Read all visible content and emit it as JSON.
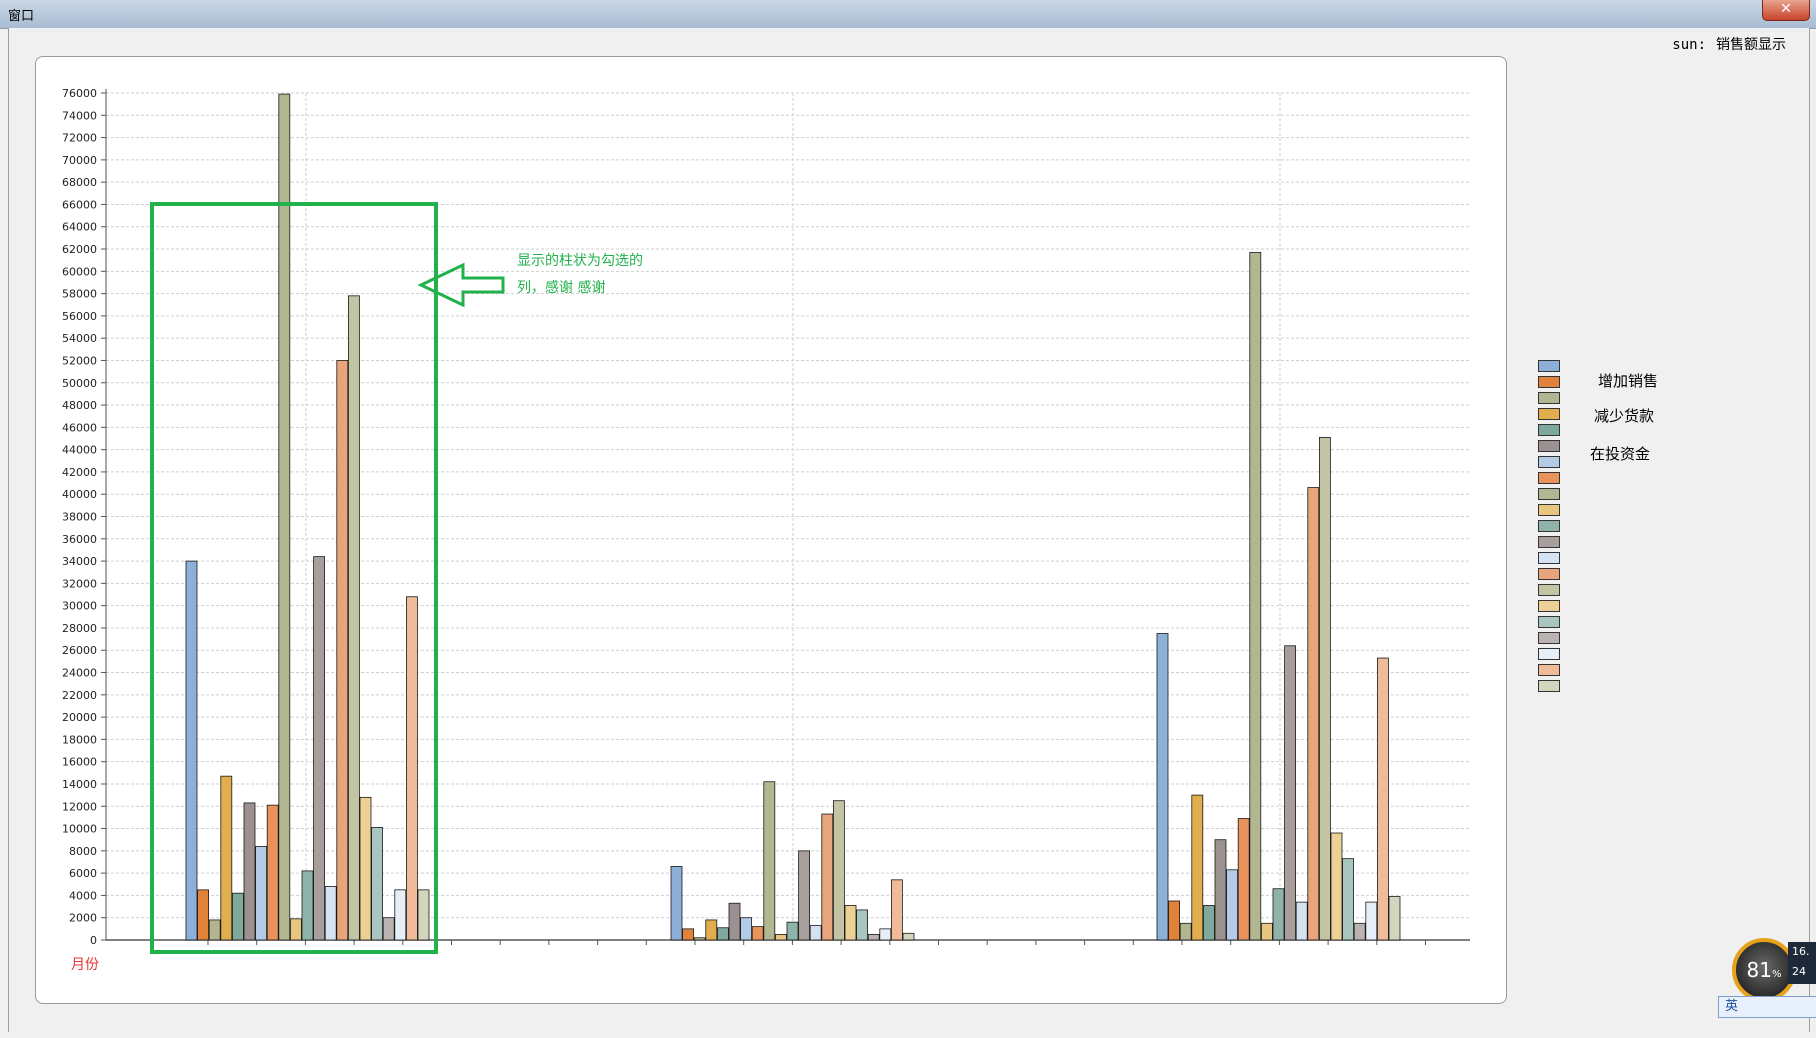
{
  "window": {
    "title": "窗口",
    "close_glyph": "✕"
  },
  "header": {
    "user": "sun:",
    "title": "销售额显示"
  },
  "chart_data": {
    "type": "bar",
    "categories": [
      "",
      "",
      ""
    ],
    "ylim": [
      0,
      76000
    ],
    "ytick_step": 2000,
    "ylabel": "",
    "xlabel": "月份",
    "grid": true,
    "series": [
      {
        "color": "#8db0d8",
        "values": [
          34000,
          6600,
          27500
        ]
      },
      {
        "color": "#e0823a",
        "values": [
          4500,
          1000,
          3500
        ]
      },
      {
        "color": "#b2b690",
        "values": [
          1800,
          200,
          1500
        ]
      },
      {
        "color": "#e2ad4e",
        "values": [
          14700,
          1800,
          13000
        ]
      },
      {
        "color": "#7fa89e",
        "values": [
          4200,
          1100,
          3100
        ]
      },
      {
        "color": "#9b9190",
        "values": [
          12300,
          3300,
          9000
        ]
      },
      {
        "color": "#b3cbe6",
        "values": [
          8400,
          2000,
          6300
        ]
      },
      {
        "color": "#e9935c",
        "values": [
          12100,
          1200,
          10900
        ]
      },
      {
        "color": "#b2b691",
        "values": [
          75900,
          14200,
          61700
        ]
      },
      {
        "color": "#e8c680",
        "values": [
          1900,
          500,
          1500
        ]
      },
      {
        "color": "#8fb3ab",
        "values": [
          6200,
          1600,
          4600
        ]
      },
      {
        "color": "#a89f9c",
        "values": [
          34400,
          8000,
          26400
        ]
      },
      {
        "color": "#d4e2f1",
        "values": [
          4800,
          1300,
          3400
        ]
      },
      {
        "color": "#e8a57c",
        "values": [
          52000,
          11300,
          40600
        ]
      },
      {
        "color": "#c2c4a4",
        "values": [
          57800,
          12500,
          45100
        ]
      },
      {
        "color": "#ecd095",
        "values": [
          12800,
          3100,
          9600
        ]
      },
      {
        "color": "#a9c5bf",
        "values": [
          10100,
          2700,
          7300
        ]
      },
      {
        "color": "#bbb3b2",
        "values": [
          2000,
          500,
          1500
        ]
      },
      {
        "color": "#e6eef7",
        "values": [
          4500,
          1000,
          3400
        ]
      },
      {
        "color": "#efbb98",
        "values": [
          30800,
          5400,
          25300
        ]
      },
      {
        "color": "#d3d5bd",
        "values": [
          4500,
          600,
          3900
        ]
      }
    ],
    "legend_labels": [
      "增加销售",
      "减少货款",
      "在投资金"
    ],
    "legend_position": "right"
  },
  "annotation": {
    "line1": "显示的柱状为勾选的",
    "line2": "列，感谢 感谢",
    "color": "#21b24b"
  },
  "tray": {
    "gauge_value": "81",
    "gauge_unit": "%",
    "speed_up": "16.",
    "speed_down": "24",
    "ime_text": "英"
  }
}
